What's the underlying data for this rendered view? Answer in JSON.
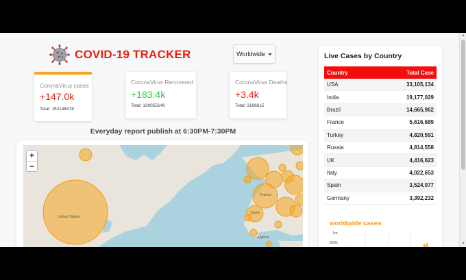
{
  "header": {
    "title": "COVID-19 TRACKER",
    "logo": "coronavirus-icon"
  },
  "region_select": {
    "selected": "Worldwide"
  },
  "cards": [
    {
      "label": "CoronaVirus cases",
      "value": "+147.0k",
      "total": "Total: 152146478",
      "color": "#e8210f",
      "active": true
    },
    {
      "label": "CoronaVirus Recovered",
      "value": "+183.4k",
      "total": "Total: 130055140",
      "color": "#2ecc40"
    },
    {
      "label": "CoronaVirus Deaths",
      "value": "+3.4k",
      "total": "Total: 3196615",
      "color": "#e8210f"
    }
  ],
  "report_text": "Everyday report publish at 6:30PM-7:30PM",
  "map": {
    "zoom_in": "+",
    "zoom_out": "−",
    "labels": {
      "usa": "United States",
      "france": "France",
      "spain": "Spain",
      "algeria": "Algeria"
    }
  },
  "live_cases": {
    "title": "Live Cases by Country",
    "col_country": "Country",
    "col_total": "Total Case",
    "rows": [
      {
        "country": "USA",
        "total": "33,105,134"
      },
      {
        "country": "India",
        "total": "19,177,029"
      },
      {
        "country": "Brazil",
        "total": "14,665,962"
      },
      {
        "country": "France",
        "total": "5,616,689"
      },
      {
        "country": "Turkey",
        "total": "4,820,591"
      },
      {
        "country": "Russia",
        "total": "4,814,558"
      },
      {
        "country": "UK",
        "total": "4,416,623"
      },
      {
        "country": "Italy",
        "total": "4,022,653"
      },
      {
        "country": "Spain",
        "total": "3,524,077"
      },
      {
        "country": "Germany",
        "total": "3,392,232"
      }
    ]
  },
  "worldwide_chart": {
    "title": "worldwide cases",
    "y_ticks": [
      "1m",
      "800k"
    ]
  },
  "colors": {
    "accent": "#e8210f",
    "header_red": "#f30d0d",
    "bubble": "#f6a623",
    "recovered": "#2ecc40"
  }
}
